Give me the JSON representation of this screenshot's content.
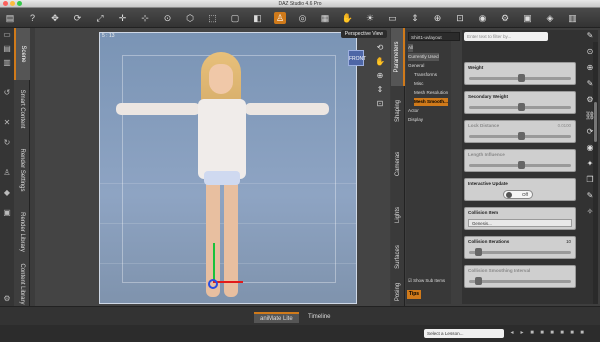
{
  "app": {
    "title": "DAZ Studio 4.6 Pro"
  },
  "colors": {
    "accent": "#d07a1a",
    "viewport_bg": "#8ea4c3"
  },
  "toolbar": {
    "icons": [
      "file-icon",
      "help-icon",
      "move-icon",
      "rotate-icon",
      "scale-icon",
      "universal-icon",
      "joint-icon",
      "node-icon",
      "geometry-icon",
      "select-icon",
      "region-icon",
      "surface-icon",
      "active-pose-icon",
      "orbit-icon",
      "spot-render-icon",
      "pan-icon",
      "light-icon",
      "camera-icon",
      "dolly-icon",
      "zoom-icon",
      "frame-icon",
      "render-icon",
      "render-settings-icon",
      "save-render-icon",
      "iray-icon",
      "aux-viewport-icon"
    ]
  },
  "left_tabs": [
    "Scene",
    "Smart Content",
    "Render Settings",
    "Render Library",
    "Content Library"
  ],
  "viewport": {
    "label": "5 : 13",
    "camera": "Perspective View",
    "navcube_label": "FRONT",
    "nav_icons": [
      "orbit-icon",
      "pan-icon",
      "zoom-icon",
      "dolly-icon",
      "frame-icon"
    ]
  },
  "right_tabs": [
    "Parameters",
    "Shaping",
    "Cameras",
    "Lights",
    "Surfaces",
    "Posing"
  ],
  "tree": {
    "dropdown": "Shirt1-uvlayout",
    "items": [
      {
        "label": "All",
        "state": "sel"
      },
      {
        "label": "Currently Used",
        "state": "sel"
      },
      {
        "label": "General",
        "state": ""
      },
      {
        "label": "Transforms",
        "state": ""
      },
      {
        "label": "Misc",
        "state": ""
      },
      {
        "label": "Mesh Resolution",
        "state": ""
      },
      {
        "label": "Mesh Smooth...",
        "state": "hl"
      },
      {
        "label": "Actor",
        "state": ""
      },
      {
        "label": "Display",
        "state": ""
      }
    ],
    "show_sub_items": "Show Sub Items",
    "tips": "Tips"
  },
  "params": {
    "filter_placeholder": "Enter text to filter by...",
    "rows": [
      {
        "label": "Weight",
        "value": "",
        "kind": "slider",
        "knob": 0.5,
        "dim": false
      },
      {
        "label": "Secondary Weight",
        "value": "",
        "kind": "slider",
        "knob": 0.5,
        "dim": false
      },
      {
        "label": "Lock Distance",
        "value": "0.0100",
        "kind": "slider",
        "knob": 0.5,
        "dim": true
      },
      {
        "label": "Length Influence",
        "value": "",
        "kind": "slider",
        "knob": 0.5,
        "dim": true
      },
      {
        "label": "Interactive Update",
        "value": "Off",
        "kind": "toggle",
        "dim": false
      },
      {
        "label": "Collision Item",
        "value": "Genesis...",
        "kind": "dropdown",
        "dim": false
      },
      {
        "label": "Collision Iterations",
        "value": "10",
        "kind": "slider",
        "knob": 0.06,
        "dim": false
      },
      {
        "label": "Collision Smoothing Interval",
        "value": "",
        "kind": "slider",
        "knob": 0.06,
        "dim": true
      }
    ],
    "side_icons": [
      "pin-icon",
      "lock-icon",
      "gear-icon",
      "pencil-icon",
      "filter-icon",
      "link-icon",
      "refresh-icon",
      "eye-icon",
      "star-icon",
      "copy-icon",
      "brush-icon",
      "key-icon"
    ]
  },
  "bottom": {
    "tabs": [
      "aniMate Lite",
      "Timeline"
    ],
    "lesson_placeholder": "Select a Lesson..."
  }
}
